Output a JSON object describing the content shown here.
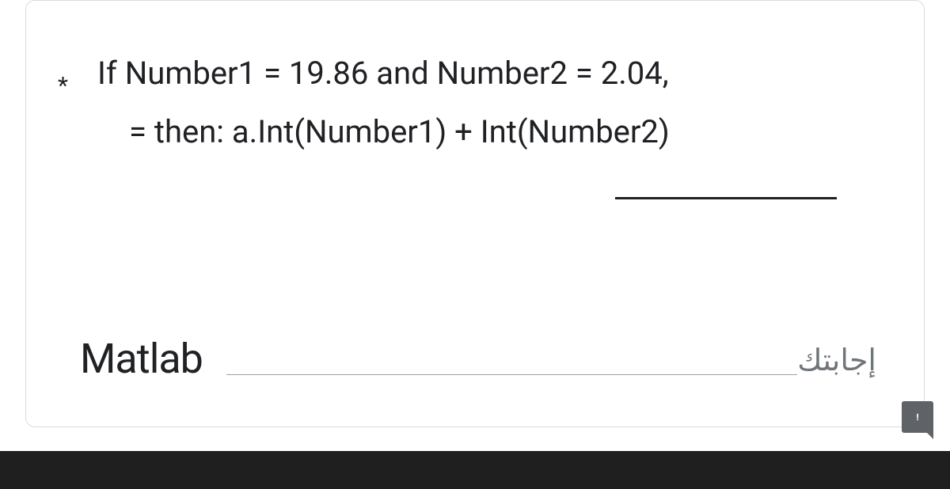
{
  "question": {
    "required_marker": "*",
    "line1": "If Number1 = 19.86 and Number2 = 2.04,",
    "line2": "= then:  a.Int(Number1) + Int(Number2)"
  },
  "answer": {
    "value": "Matlab",
    "label": "إجابتك"
  },
  "icons": {
    "feedback": "feedback-icon"
  }
}
